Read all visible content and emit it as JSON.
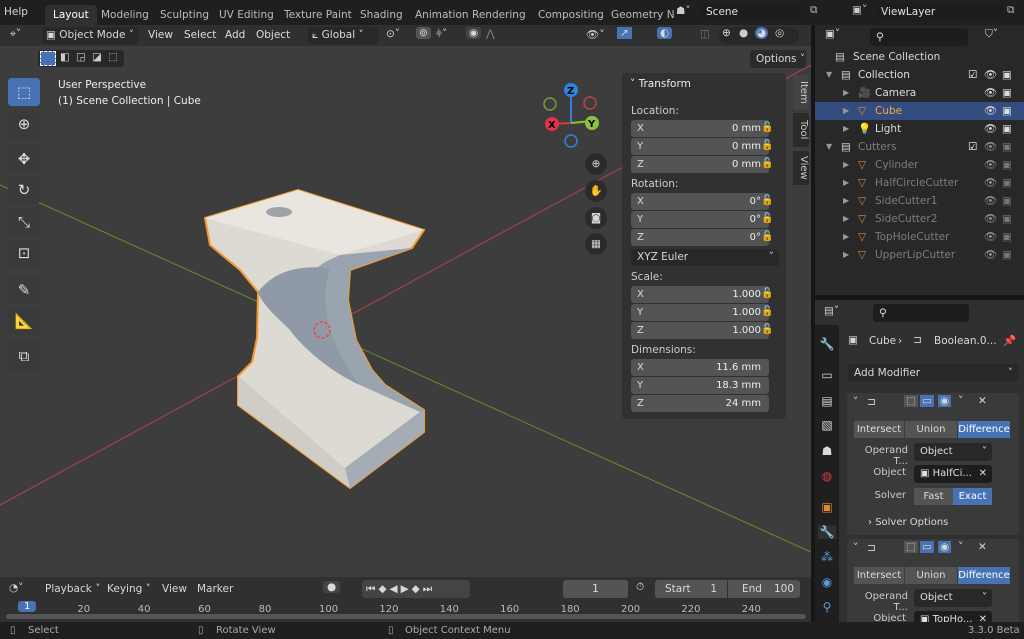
{
  "topbar": {
    "help": "Help",
    "workspaces": [
      "Layout",
      "Modeling",
      "Sculpting",
      "UV Editing",
      "Texture Paint",
      "Shading",
      "Animation",
      "Rendering",
      "Compositing",
      "Geometry N"
    ],
    "active": "Layout",
    "scene": "Scene",
    "view_layer": "ViewLayer"
  },
  "viewport": {
    "mode": "Object Mode",
    "menus": [
      "View",
      "Select",
      "Add",
      "Object"
    ],
    "orientation": "Global",
    "options": "Options",
    "overlay_title": "User Perspective",
    "overlay_sub": "(1) Scene Collection | Cube",
    "axis_colors": {
      "x": "#e0344c",
      "y": "#8bc43a",
      "z": "#2f84e0"
    },
    "gizmo_labels": {
      "x": "X",
      "y": "Y",
      "z": "Z"
    }
  },
  "npanel": {
    "title": "Transform",
    "tabs": [
      "Item",
      "Tool",
      "View"
    ],
    "location_label": "Location:",
    "location": [
      [
        "X",
        "0 mm"
      ],
      [
        "Y",
        "0 mm"
      ],
      [
        "Z",
        "0 mm"
      ]
    ],
    "rotation_label": "Rotation:",
    "rotation": [
      [
        "X",
        "0°"
      ],
      [
        "Y",
        "0°"
      ],
      [
        "Z",
        "0°"
      ]
    ],
    "rotation_mode": "XYZ Euler",
    "scale_label": "Scale:",
    "scale": [
      [
        "X",
        "1.000"
      ],
      [
        "Y",
        "1.000"
      ],
      [
        "Z",
        "1.000"
      ]
    ],
    "dimensions_label": "Dimensions:",
    "dimensions": [
      [
        "X",
        "11.6 mm"
      ],
      [
        "Y",
        "18.3 mm"
      ],
      [
        "Z",
        "24 mm"
      ]
    ]
  },
  "outliner": {
    "root": "Scene Collection",
    "items": [
      {
        "name": "Collection",
        "level": 0,
        "type": "collection"
      },
      {
        "name": "Camera",
        "level": 1,
        "type": "camera"
      },
      {
        "name": "Cube",
        "level": 1,
        "type": "mesh",
        "selected": true
      },
      {
        "name": "Light",
        "level": 1,
        "type": "light"
      },
      {
        "name": "Cutters",
        "level": 0,
        "type": "collection",
        "dim": true
      },
      {
        "name": "Cylinder",
        "level": 1,
        "type": "mesh",
        "dim": true
      },
      {
        "name": "HalfCircleCutter",
        "level": 1,
        "type": "mesh",
        "dim": true
      },
      {
        "name": "SideCutter1",
        "level": 1,
        "type": "mesh",
        "dim": true
      },
      {
        "name": "SideCutter2",
        "level": 1,
        "type": "mesh",
        "dim": true
      },
      {
        "name": "TopHoleCutter",
        "level": 1,
        "type": "mesh",
        "dim": true
      },
      {
        "name": "UpperLipCutter",
        "level": 1,
        "type": "mesh",
        "dim": true
      }
    ]
  },
  "properties": {
    "breadcrumb_object": "Cube",
    "breadcrumb_modifier": "Boolean.0...",
    "add_modifier": "Add Modifier",
    "modifiers": [
      {
        "ops": [
          "Intersect",
          "Union",
          "Difference"
        ],
        "active_op": "Difference",
        "operand_label": "Operand T...",
        "operand": "Object",
        "object_label": "Object",
        "object": "HalfCi...",
        "solver_label": "Solver",
        "solvers": [
          "Fast",
          "Exact"
        ],
        "active_solver": "Exact",
        "solver_options": "Solver Options"
      },
      {
        "ops": [
          "Intersect",
          "Union",
          "Difference"
        ],
        "active_op": "Difference",
        "operand_label": "Operand T...",
        "operand": "Object",
        "object_label": "Object",
        "object": "TopHo..."
      }
    ]
  },
  "timeline": {
    "menus": [
      "Playback",
      "Keying",
      "View",
      "Marker"
    ],
    "current_frame": "1",
    "start_label": "Start",
    "start": "1",
    "end_label": "End",
    "end": "100",
    "ticks": [
      "1",
      "20",
      "40",
      "60",
      "80",
      "100",
      "120",
      "140",
      "160",
      "180",
      "200",
      "220",
      "240"
    ]
  },
  "status": {
    "select": "Select",
    "rotate": "Rotate View",
    "context": "Object Context Menu",
    "version": "3.3.0 Beta"
  }
}
